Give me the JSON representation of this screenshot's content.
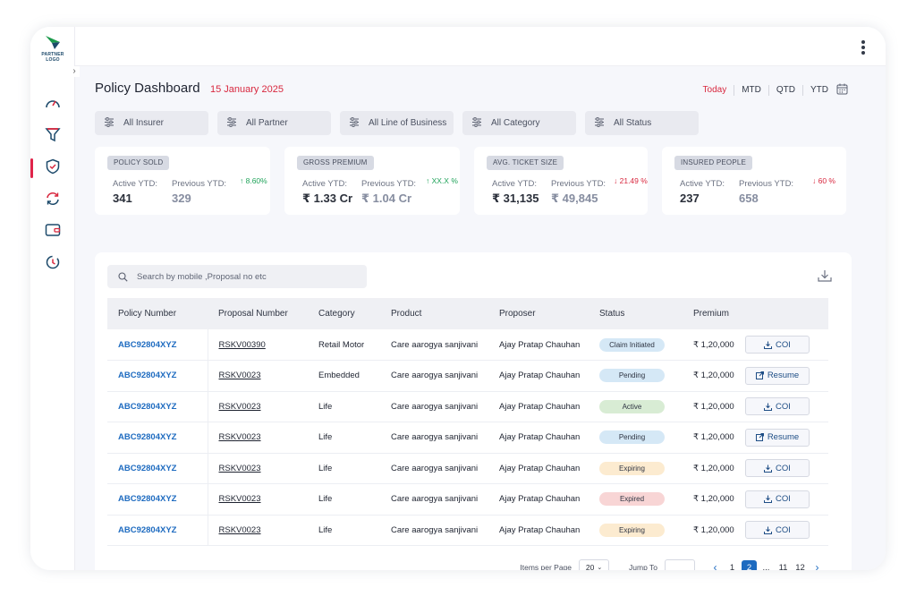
{
  "app": {
    "logo_text": "PARTNER LOGO"
  },
  "sidebar": {
    "items": [
      {
        "icon": "speedometer-icon",
        "active": false
      },
      {
        "icon": "funnel-icon",
        "active": false
      },
      {
        "icon": "shield-check-icon",
        "active": true
      },
      {
        "icon": "refresh-icon",
        "active": false
      },
      {
        "icon": "wallet-icon",
        "active": false
      },
      {
        "icon": "renewal-icon",
        "active": false
      }
    ]
  },
  "header": {
    "title": "Policy Dashboard",
    "date": "15 January 2025",
    "periods": [
      "Today",
      "MTD",
      "QTD",
      "YTD"
    ],
    "accent_color": "#d8283f"
  },
  "filters": [
    "All Insurer",
    "All Partner",
    "All Line of Business",
    "All Category",
    "All Status"
  ],
  "kpis": [
    {
      "title": "POLICY SOLD",
      "active_label": "Active YTD:",
      "active_value": "341",
      "prev_label": "Previous YTD:",
      "prev_value": "329",
      "change": "↑ 8.60%",
      "trend": "up"
    },
    {
      "title": "GROSS PREMIUM",
      "active_label": "Active YTD:",
      "active_value": "₹ 1.33 Cr",
      "prev_label": "Previous YTD:",
      "prev_value": "₹ 1.04 Cr",
      "change": "↑ XX.X %",
      "trend": "up"
    },
    {
      "title": "AVG. TICKET SIZE",
      "active_label": "Active YTD:",
      "active_value": "₹ 31,135",
      "prev_label": "Previous YTD:",
      "prev_value": "₹ 49,845",
      "change": "↓ 21.49 %",
      "trend": "down"
    },
    {
      "title": "INSURED PEOPLE",
      "active_label": "Active YTD:",
      "active_value": "237",
      "prev_label": "Previous YTD:",
      "prev_value": "658",
      "change": "↓ 60 %",
      "trend": "down"
    }
  ],
  "search": {
    "placeholder": "Search by mobile ,Proposal no etc"
  },
  "table": {
    "columns": [
      "Policy Number",
      "Proposal Number",
      "Category",
      "Product",
      "Proposer",
      "Status",
      "Premium"
    ],
    "rows": [
      {
        "policy": "ABC92804XYZ",
        "proposal": "RSKV00390",
        "category": "Retail Motor",
        "product": "Care aarogya sanjivani",
        "proposer": "Ajay Pratap Chauhan",
        "status": "Claim Initiated",
        "status_type": "claim",
        "premium": "₹ 1,20,000",
        "action": "COI",
        "action_icon": "download-icon"
      },
      {
        "policy": "ABC92804XYZ",
        "proposal": "RSKV0023",
        "category": "Embedded",
        "product": "Care aarogya sanjivani",
        "proposer": "Ajay Pratap Chauhan",
        "status": "Pending",
        "status_type": "pending",
        "premium": "₹ 1,20,000",
        "action": "Resume",
        "action_icon": "external-link-icon"
      },
      {
        "policy": "ABC92804XYZ",
        "proposal": "RSKV0023",
        "category": "Life",
        "product": "Care aarogya sanjivani",
        "proposer": "Ajay Pratap Chauhan",
        "status": "Active",
        "status_type": "active",
        "premium": "₹ 1,20,000",
        "action": "COI",
        "action_icon": "download-icon"
      },
      {
        "policy": "ABC92804XYZ",
        "proposal": "RSKV0023",
        "category": "Life",
        "product": "Care aarogya sanjivani",
        "proposer": "Ajay Pratap Chauhan",
        "status": "Pending",
        "status_type": "pending",
        "premium": "₹ 1,20,000",
        "action": "Resume",
        "action_icon": "external-link-icon"
      },
      {
        "policy": "ABC92804XYZ",
        "proposal": "RSKV0023",
        "category": "Life",
        "product": "Care aarogya sanjivani",
        "proposer": "Ajay Pratap Chauhan",
        "status": "Expiring",
        "status_type": "expiring",
        "premium": "₹ 1,20,000",
        "action": "COI",
        "action_icon": "download-icon"
      },
      {
        "policy": "ABC92804XYZ",
        "proposal": "RSKV0023",
        "category": "Life",
        "product": "Care aarogya sanjivani",
        "proposer": "Ajay Pratap Chauhan",
        "status": "Expired",
        "status_type": "expired",
        "premium": "₹ 1,20,000",
        "action": "COI",
        "action_icon": "download-icon"
      },
      {
        "policy": "ABC92804XYZ",
        "proposal": "RSKV0023",
        "category": "Life",
        "product": "Care aarogya sanjivani",
        "proposer": "Ajay Pratap Chauhan",
        "status": "Expiring",
        "status_type": "expiring",
        "premium": "₹ 1,20,000",
        "action": "COI",
        "action_icon": "download-icon"
      }
    ]
  },
  "pagination": {
    "items_per_page_label": "Items per Page",
    "items_per_page": "20",
    "jump_label": "Jump To",
    "pages": [
      "1",
      "2",
      "...",
      "11",
      "12"
    ],
    "current_page": "2"
  }
}
